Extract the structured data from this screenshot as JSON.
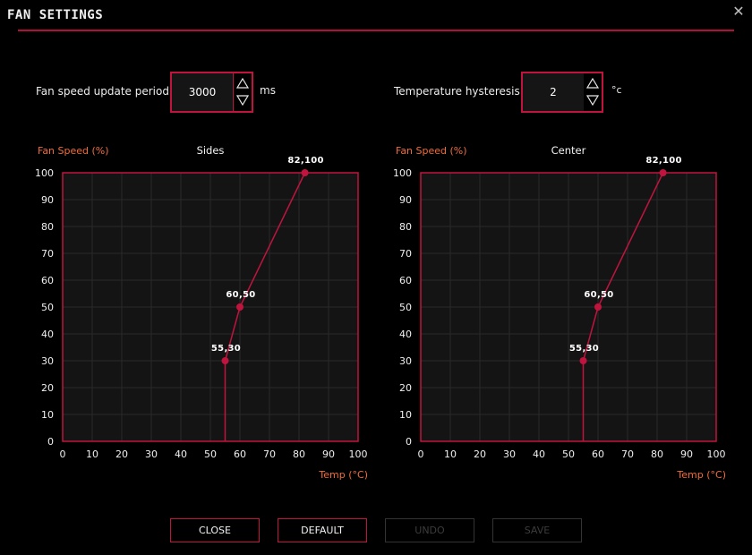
{
  "window": {
    "title": "FAN SETTINGS",
    "close_icon": "close-x-icon"
  },
  "settings": {
    "update_period": {
      "label": "Fan speed update period:",
      "value": "3000",
      "unit": "ms"
    },
    "hysteresis": {
      "label": "Temperature hysteresis:",
      "value": "2",
      "unit": "°c"
    },
    "spin_up_icon": "triangle-up-outline-icon",
    "spin_down_icon": "triangle-down-outline-icon"
  },
  "colors": {
    "accent": "#c0143e",
    "axis_label": "#ee6c3c",
    "plot_bg": "#141414",
    "grid": "#2a2a2a"
  },
  "chart_data": [
    {
      "type": "line",
      "title": "Sides",
      "ylabel": "Fan Speed (%)",
      "xlabel": "Temp (°C)",
      "xlim": [
        0,
        100
      ],
      "ylim": [
        0,
        100
      ],
      "grid": true,
      "xticks": [
        0,
        10,
        20,
        30,
        40,
        50,
        60,
        70,
        80,
        90,
        100
      ],
      "yticks": [
        0,
        10,
        20,
        30,
        40,
        50,
        60,
        70,
        80,
        90,
        100
      ],
      "series": [
        {
          "name": "Sides",
          "points": [
            [
              55,
              0
            ],
            [
              55,
              30
            ],
            [
              60,
              50
            ],
            [
              82,
              100
            ]
          ]
        }
      ],
      "annotations": [
        {
          "x": 55,
          "y": 30,
          "text": "55,30"
        },
        {
          "x": 60,
          "y": 50,
          "text": "60,50"
        },
        {
          "x": 82,
          "y": 100,
          "text": "82,100"
        }
      ]
    },
    {
      "type": "line",
      "title": "Center",
      "ylabel": "Fan Speed (%)",
      "xlabel": "Temp (°C)",
      "xlim": [
        0,
        100
      ],
      "ylim": [
        0,
        100
      ],
      "grid": true,
      "xticks": [
        0,
        10,
        20,
        30,
        40,
        50,
        60,
        70,
        80,
        90,
        100
      ],
      "yticks": [
        0,
        10,
        20,
        30,
        40,
        50,
        60,
        70,
        80,
        90,
        100
      ],
      "series": [
        {
          "name": "Center",
          "points": [
            [
              55,
              0
            ],
            [
              55,
              30
            ],
            [
              60,
              50
            ],
            [
              82,
              100
            ]
          ]
        }
      ],
      "annotations": [
        {
          "x": 55,
          "y": 30,
          "text": "55,30"
        },
        {
          "x": 60,
          "y": 50,
          "text": "60,50"
        },
        {
          "x": 82,
          "y": 100,
          "text": "82,100"
        }
      ]
    }
  ],
  "buttons": {
    "close": {
      "label": "CLOSE",
      "enabled": true
    },
    "default": {
      "label": "DEFAULT",
      "enabled": true
    },
    "undo": {
      "label": "UNDO",
      "enabled": false
    },
    "save": {
      "label": "SAVE",
      "enabled": false
    }
  }
}
